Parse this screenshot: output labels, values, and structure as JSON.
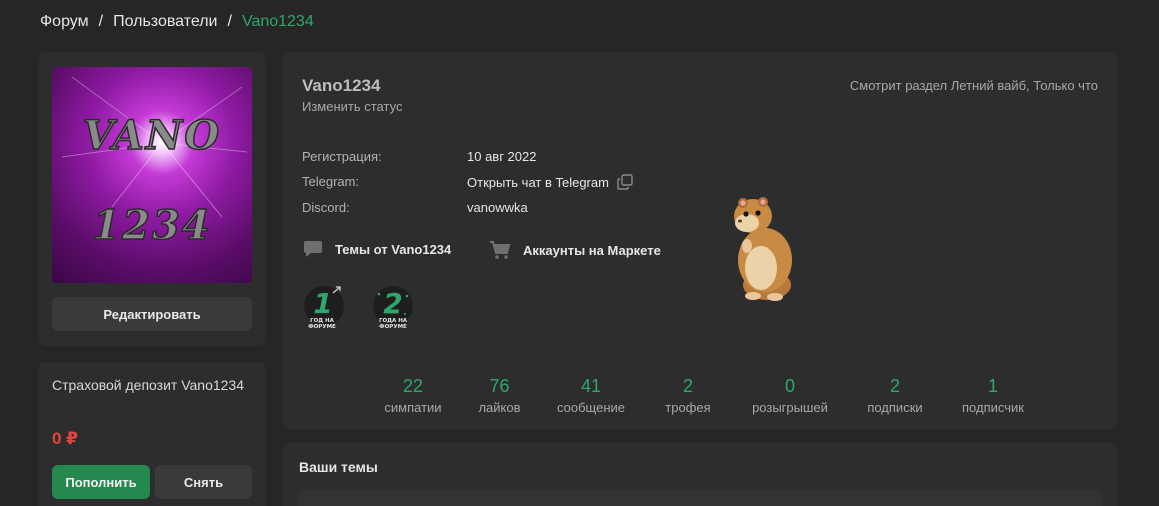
{
  "breadcrumb": {
    "forum": "Форум",
    "sep1": "/",
    "users": "Пользователи",
    "sep2": "/",
    "current": "Vano1234"
  },
  "avatar": {
    "line1": "VANO",
    "line2": "1234"
  },
  "sidebar": {
    "edit_label": "Редактировать",
    "deposit_title": "Страховой депозит Vano1234",
    "deposit_amount": "0 ₽",
    "topup_label": "Пополнить",
    "withdraw_label": "Снять"
  },
  "profile": {
    "username": "Vano1234",
    "change_status": "Изменить статус",
    "last_seen": "Смотрит раздел Летний вайб, Только что",
    "info": [
      {
        "label": "Регистрация:",
        "value": "10 авг 2022"
      },
      {
        "label": "Telegram:",
        "value": "Открыть чат в Telegram"
      },
      {
        "label": "Discord:",
        "value": "vanowwka"
      }
    ],
    "links": {
      "topics": "Темы от Vano1234",
      "market": "Аккаунты на Маркете"
    },
    "trophies": [
      {
        "num": "1",
        "caption1": "ГОД НА",
        "caption2": "ФОРУМЕ"
      },
      {
        "num": "2",
        "caption1": "ГОДА НА",
        "caption2": "ФОРУМЕ"
      }
    ],
    "stats": [
      {
        "num": "22",
        "label": "симпатии"
      },
      {
        "num": "76",
        "label": "лайков"
      },
      {
        "num": "41",
        "label": "сообщение"
      },
      {
        "num": "2",
        "label": "трофея"
      },
      {
        "num": "0",
        "label": "розыгрышей"
      },
      {
        "num": "2",
        "label": "подписки"
      },
      {
        "num": "1",
        "label": "подписчик"
      }
    ]
  },
  "topics": {
    "title": "Ваши темы"
  },
  "colors": {
    "accent": "#2ea86a",
    "danger": "#e2463d",
    "background": "#262626",
    "card": "#2d2d2d"
  }
}
